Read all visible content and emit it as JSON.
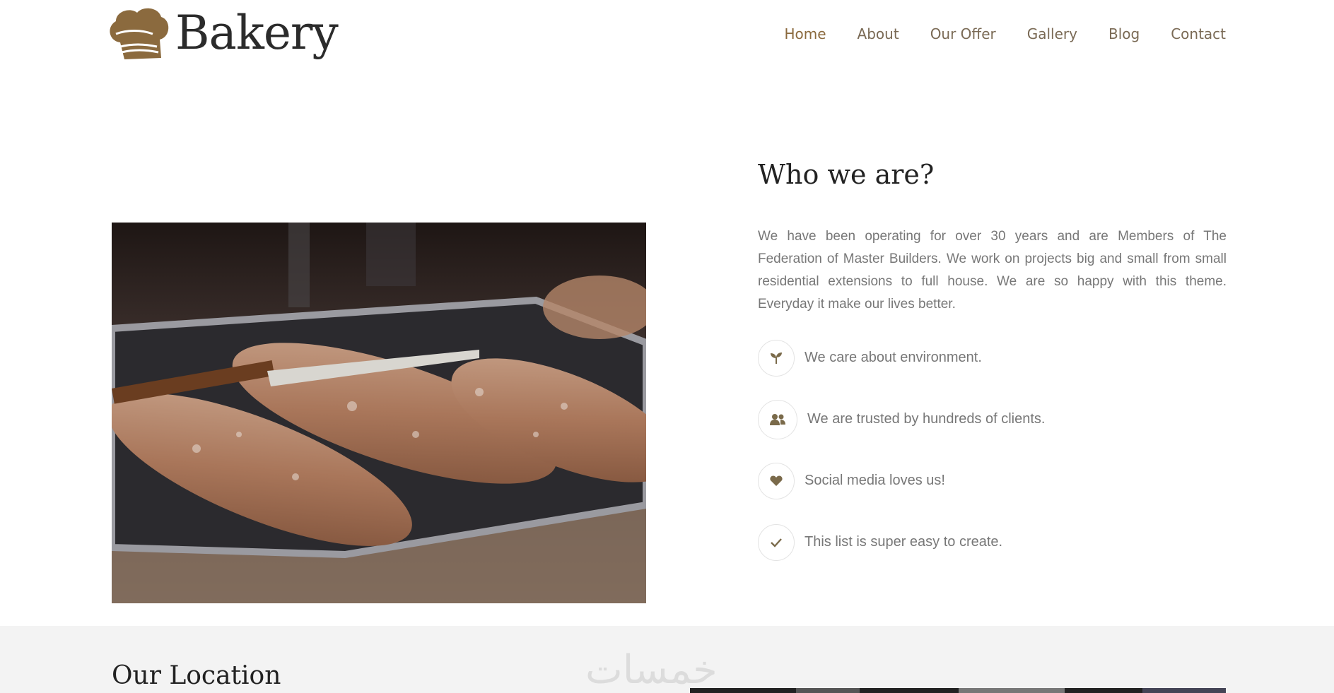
{
  "brand": {
    "name": "Bakery"
  },
  "nav": {
    "items": [
      {
        "label": "Home",
        "active": true
      },
      {
        "label": "About"
      },
      {
        "label": "Our Offer"
      },
      {
        "label": "Gallery"
      },
      {
        "label": "Blog"
      },
      {
        "label": "Contact"
      }
    ]
  },
  "about": {
    "title": "Who we are?",
    "body": "We have been operating for over 30 years and are Members of The Federation of Master Builders. We work on projects big and small from small residential extensions to full house. We are so happy with this theme. Everyday it make our lives better.",
    "features": [
      {
        "icon": "seedling-icon",
        "text": "We care about environment."
      },
      {
        "icon": "users-icon",
        "text": "We are trusted by hundreds of clients."
      },
      {
        "icon": "heart-icon",
        "text": "Social media loves us!"
      },
      {
        "icon": "check-icon",
        "text": "This list is super easy to create."
      }
    ]
  },
  "location": {
    "title": "Our Location",
    "watermark": "خمسات"
  },
  "colors": {
    "accent": "#8b6a3e",
    "band": "#f3f3f3",
    "text": "#777777"
  }
}
